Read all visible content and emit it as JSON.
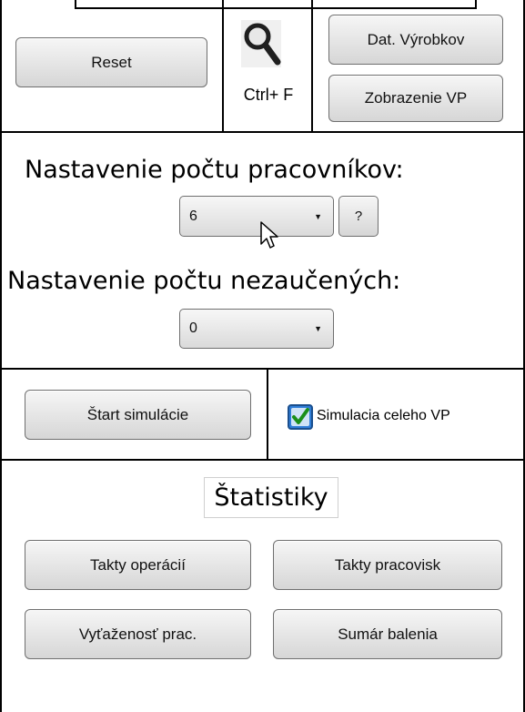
{
  "toolbar": {
    "reset_label": "Reset",
    "search_shortcut": "Ctrl+ F",
    "product_data_label": "Dat. Výrobkov",
    "show_vp_label": "Zobrazenie VP"
  },
  "workers": {
    "heading": "Nastavenie počtu pracovníkov:",
    "selected": "6",
    "help_label": "?"
  },
  "untrained": {
    "heading": "Nastavenie počtu nezaučených:",
    "selected": "0"
  },
  "simulation": {
    "start_label": "Štart simulácie",
    "whole_vp_label": "Simulacia celeho VP",
    "whole_vp_checked": true
  },
  "statistics": {
    "heading": "Štatistiky",
    "op_cycles_label": "Takty operácií",
    "workplace_cycles_label": "Takty pracovisk",
    "utilization_label": "Vyťaženosť prac.",
    "packaging_summary_label": "Sumár balenia"
  },
  "icons": {
    "search": "magnifier-icon",
    "cursor": "mouse-pointer-icon",
    "check": "checkmark-icon"
  }
}
